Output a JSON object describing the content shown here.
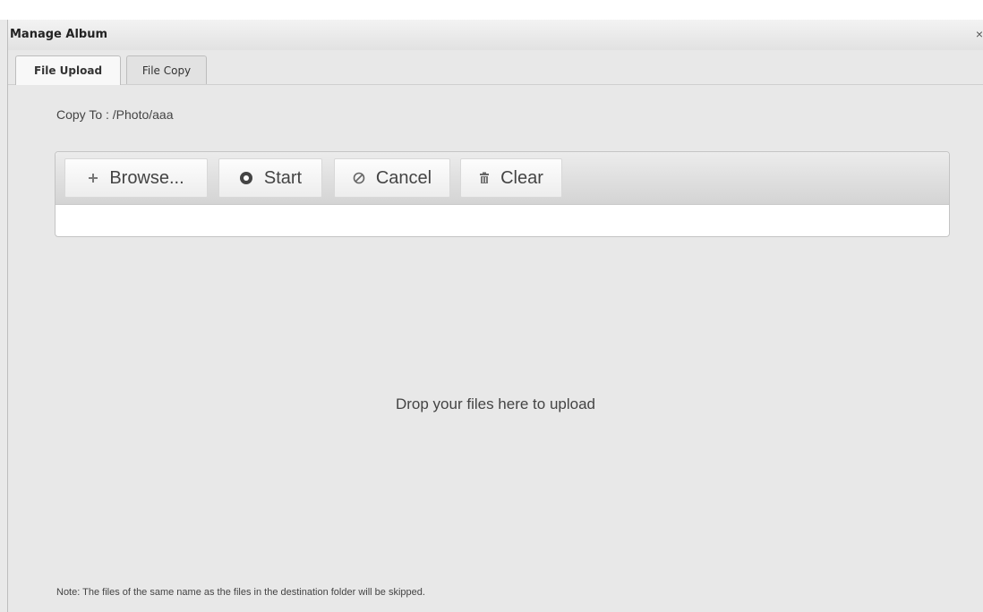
{
  "dialog": {
    "title": "Manage Album",
    "close_glyph": "×"
  },
  "tabs": [
    {
      "label": "File Upload",
      "active": true
    },
    {
      "label": "File Copy",
      "active": false
    }
  ],
  "copy_to": "Copy To : /Photo/aaa",
  "toolbar": {
    "browse_label": "Browse...",
    "start_label": "Start",
    "cancel_label": "Cancel",
    "clear_label": "Clear",
    "icons": {
      "browse": "plus-icon",
      "start": "circle-icon",
      "cancel": "cancel-icon",
      "clear": "trash-icon"
    }
  },
  "drop_zone_text": "Drop your files here to upload",
  "note": "Note: The files of the same name as the files in the destination folder will be skipped."
}
